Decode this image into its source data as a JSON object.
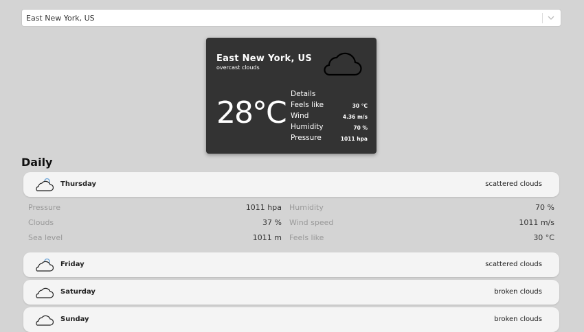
{
  "search": {
    "value": "East New York, US"
  },
  "current": {
    "city": "East New York, US",
    "description": "overcast clouds",
    "temperature": "28°C",
    "details_title": "Details",
    "details": [
      {
        "label": "Feels like",
        "value": "30 °C"
      },
      {
        "label": "Wind",
        "value": "4.36 m/s"
      },
      {
        "label": "Humidity",
        "value": "70 %"
      },
      {
        "label": "Pressure",
        "value": "1011 hpa"
      }
    ]
  },
  "daily": {
    "title": "Daily",
    "days": [
      {
        "name": "Thursday",
        "description": "scattered clouds",
        "icon": "scattered-clouds-icon"
      },
      {
        "name": "Friday",
        "description": "scattered clouds",
        "icon": "scattered-clouds-icon"
      },
      {
        "name": "Saturday",
        "description": "broken clouds",
        "icon": "cloud-icon"
      },
      {
        "name": "Sunday",
        "description": "broken clouds",
        "icon": "cloud-icon"
      }
    ],
    "expanded": {
      "left": [
        {
          "label": "Pressure",
          "value": "1011 hpa"
        },
        {
          "label": "Clouds",
          "value": "37 %"
        },
        {
          "label": "Sea level",
          "value": "1011 m"
        }
      ],
      "right": [
        {
          "label": "Humidity",
          "value": "70 %"
        },
        {
          "label": "Wind speed",
          "value": "1011 m/s"
        },
        {
          "label": "Feels like",
          "value": "30 °C"
        }
      ]
    }
  }
}
